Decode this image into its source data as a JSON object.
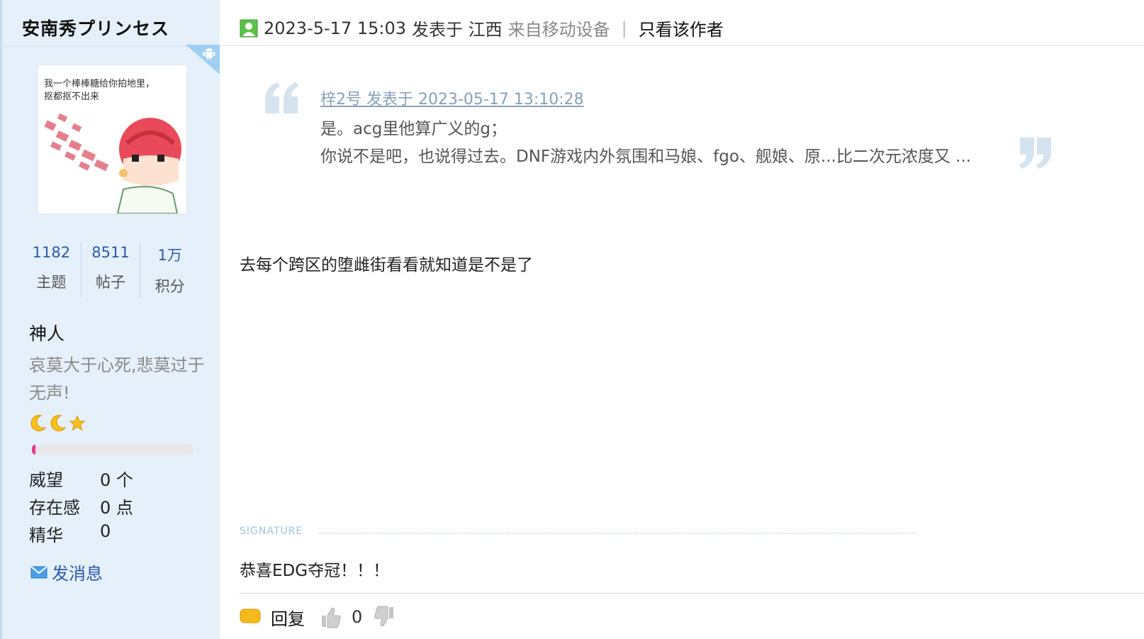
{
  "author": {
    "name": "安南秀プリンセス",
    "avatar_caption": [
      "我一个棒棒糖给你拍地里，",
      "抠都抠不出来"
    ],
    "stats": [
      {
        "value": "1182",
        "label": "主题"
      },
      {
        "value": "8511",
        "label": "帖子"
      },
      {
        "value": "1万",
        "label": "积分"
      }
    ],
    "group": "神人",
    "motto": "哀莫大于心死,悲莫过于无声!",
    "medals": [
      "moon-icon",
      "moon-icon",
      "star-icon"
    ],
    "level_progress": 0.02,
    "info": [
      {
        "key": "威望",
        "value": "0 个"
      },
      {
        "key": "存在感",
        "value": "0 点"
      },
      {
        "key": "精华",
        "value": "0"
      }
    ],
    "send_message": "发消息"
  },
  "post": {
    "date": "2023-5-17 15:03",
    "posted_in": "发表于 江西",
    "device": "来自移动设备",
    "separator": "|",
    "only_author": "只看该作者",
    "quote": {
      "meta": "梓2号 发表于 2023-05-17 13:10:28",
      "line1": "是。acg里他算广义的g；",
      "line2": "你说不是吧，也说得过去。DNF游戏内外氛围和马娘、fgo、舰娘、原...比二次元浓度又 ..."
    },
    "body": "去每个跨区的堕雌街看看就知道是不是了",
    "signature_label": "SIGNATURE",
    "signature_text": "恭喜EDG夺冠！！！",
    "reply_label": "回复",
    "like_count": "0"
  },
  "colors": {
    "sidebar_bg": "#e6f0fb",
    "link_blue": "#2a5aa8",
    "quote_mark": "#d5e3ee",
    "progress_fill": "#e93a8c"
  }
}
